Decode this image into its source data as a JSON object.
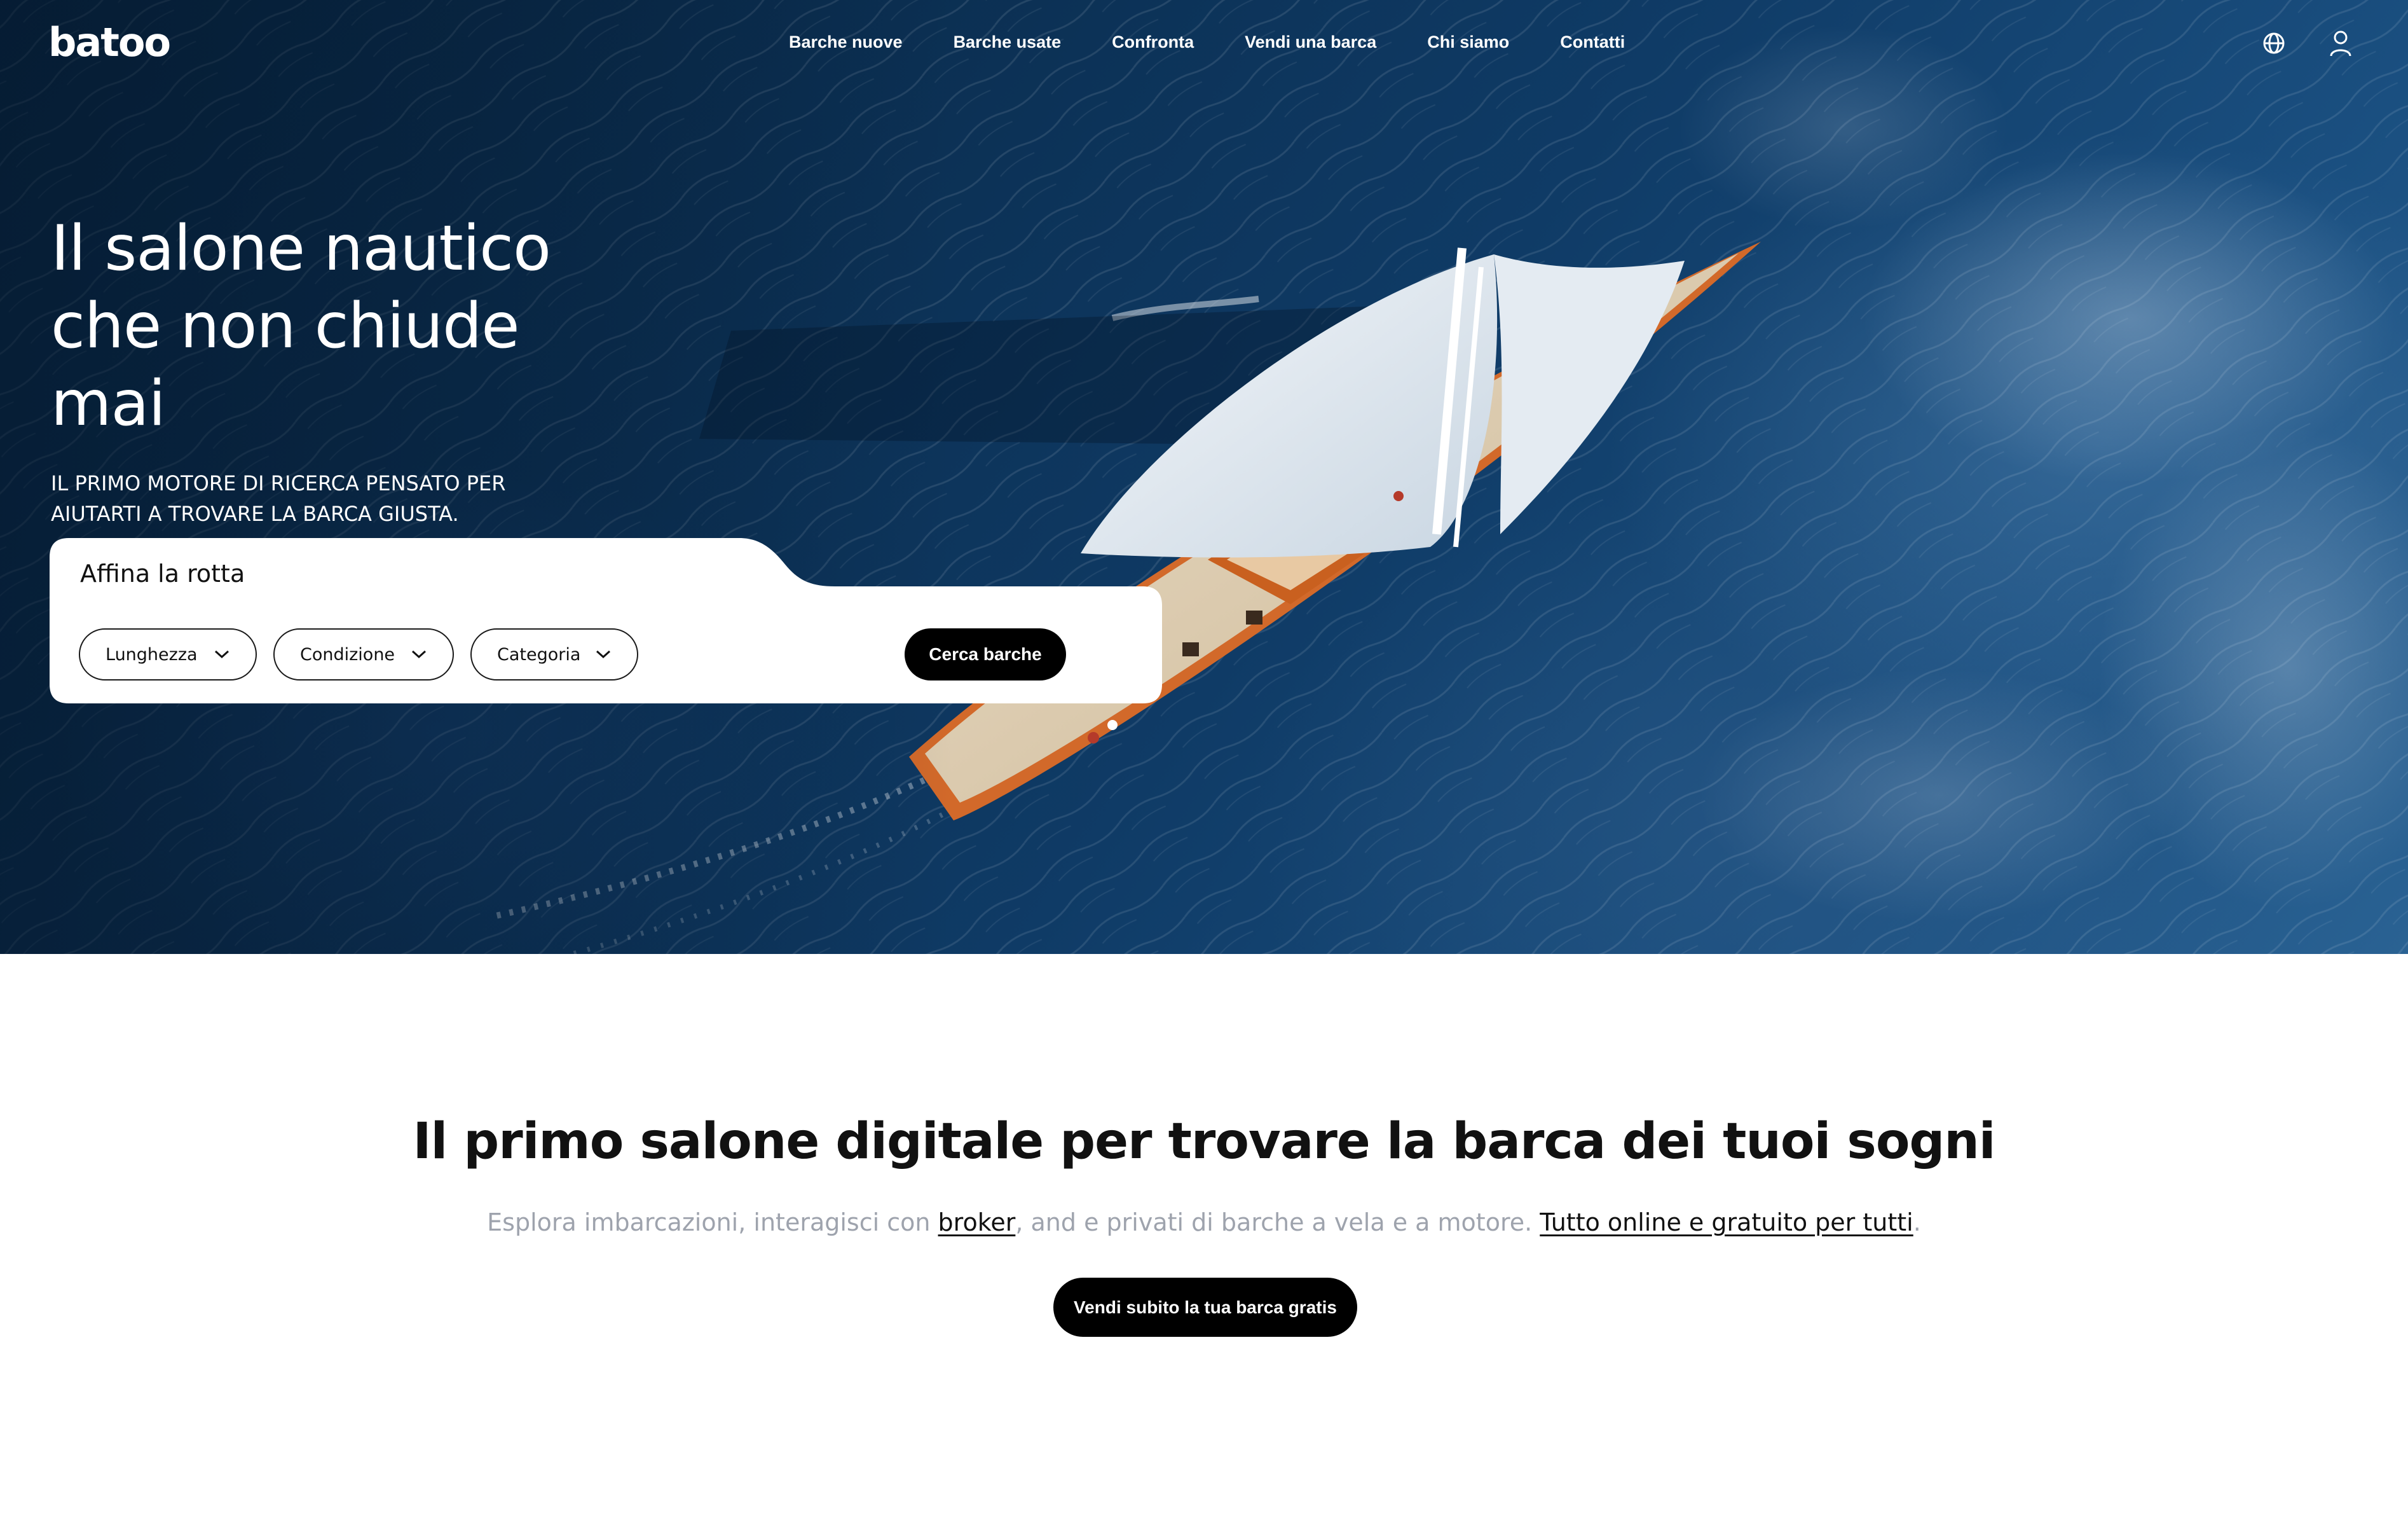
{
  "brand": {
    "logo_text": "batoo"
  },
  "nav": {
    "items": [
      {
        "label": "Barche nuove"
      },
      {
        "label": "Barche usate"
      },
      {
        "label": "Confronta"
      },
      {
        "label": "Vendi una barca"
      },
      {
        "label": "Chi siamo"
      },
      {
        "label": "Contatti"
      }
    ],
    "icons": [
      "globe-icon",
      "user-icon"
    ]
  },
  "hero": {
    "title": "Il salone nautico che non chiude mai",
    "subtitle": "IL PRIMO MOTORE DI RICERCA PENSATO PER AIUTARTI A TROVARE LA BARCA GIUSTA.",
    "background": "aerial photo of sailboat on deep blue sea"
  },
  "search": {
    "title": "Affina la rotta",
    "filters": [
      {
        "label": "Lunghezza"
      },
      {
        "label": "Condizione"
      },
      {
        "label": "Categoria"
      }
    ],
    "submit_label": "Cerca barche"
  },
  "intro": {
    "title": "Il primo salone digitale per trovare la barca dei tuoi sogni",
    "desc_part1": "Esplora imbarcazioni, interagisci con ",
    "desc_link1": "broker",
    "desc_part2": ", and e privati di barche a vela e a motore. ",
    "desc_link2": "Tutto online e gratuito per tutti",
    "desc_part3": ".",
    "cta_label": "Vendi subito la tua barca gratis"
  },
  "colors": {
    "sea_dark": "#0b2f52",
    "sea_light": "#2a6293",
    "text_dark": "#111111",
    "text_muted": "#9ea3ad",
    "button_bg": "#000000",
    "button_text": "#ffffff",
    "hull_orange": "#d2692a"
  }
}
